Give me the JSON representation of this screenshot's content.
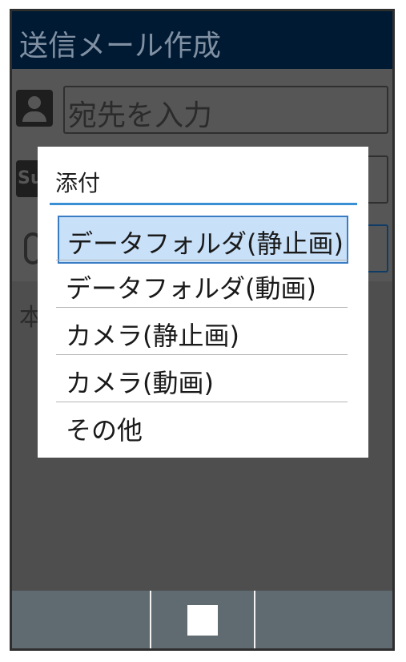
{
  "header": {
    "title": "送信メール作成"
  },
  "compose": {
    "to_placeholder": "宛先を入力",
    "subject_icon_text": "Su",
    "body_label": "本"
  },
  "dialog": {
    "title": "添付",
    "items": [
      {
        "label": "データフォルダ(静止画)"
      },
      {
        "label": "データフォルダ(動画)"
      },
      {
        "label": "カメラ(静止画)"
      },
      {
        "label": "カメラ(動画)"
      },
      {
        "label": "その他"
      }
    ],
    "selected_index": 0
  },
  "colors": {
    "titlebar": "#001a33",
    "selection": "#c8e0f8",
    "selection_border": "#3a7cc4",
    "accent_rule": "#3a90d4"
  },
  "icons": [
    "person-icon",
    "subject-icon",
    "paperclip-icon",
    "center-softkey-icon"
  ]
}
